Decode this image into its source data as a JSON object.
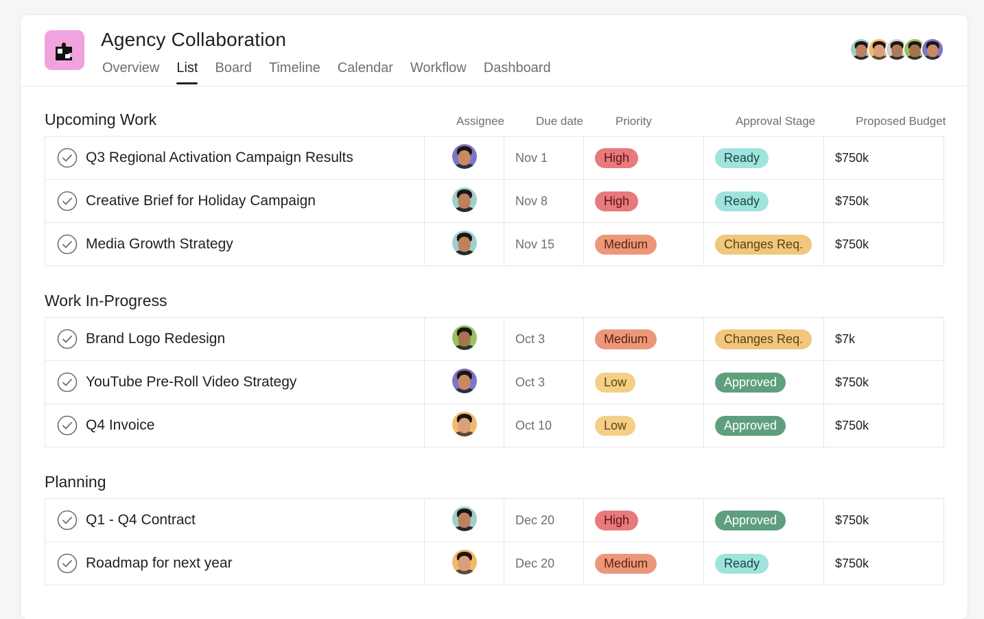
{
  "project": {
    "title": "Agency Collaboration",
    "logo_icon": "puzzle-icon",
    "logo_color": "#f0a3dd"
  },
  "tabs": [
    {
      "label": "Overview",
      "active": false
    },
    {
      "label": "List",
      "active": true
    },
    {
      "label": "Board",
      "active": false
    },
    {
      "label": "Timeline",
      "active": false
    },
    {
      "label": "Calendar",
      "active": false
    },
    {
      "label": "Workflow",
      "active": false
    },
    {
      "label": "Dashboard",
      "active": false
    }
  ],
  "members": [
    "teal",
    "orange",
    "gray",
    "green",
    "purple"
  ],
  "columns": {
    "assignee": "Assignee",
    "due_date": "Due date",
    "priority": "Priority",
    "approval": "Approval Stage",
    "budget": "Proposed Budget"
  },
  "colors": {
    "high": {
      "bg": "#e8797c",
      "fg": "#5a1416"
    },
    "medium": {
      "bg": "#ec9779",
      "fg": "#5c2313"
    },
    "low": {
      "bg": "#f4cf86",
      "fg": "#5d4410"
    },
    "ready": {
      "bg": "#9fe3dd",
      "fg": "#1a4643"
    },
    "changes": {
      "bg": "#f1c67d",
      "fg": "#5b4211"
    },
    "approved": {
      "bg": "#5f9f7e",
      "fg": "#ffffff"
    }
  },
  "sections": [
    {
      "title": "Upcoming Work",
      "show_columns": true,
      "rows": [
        {
          "name": "Q3 Regional Activation Campaign Results",
          "avatar": "purple",
          "due": "Nov 1",
          "priority": "High",
          "priority_key": "high",
          "approval": "Ready",
          "approval_key": "ready",
          "budget": "$750k"
        },
        {
          "name": "Creative Brief for Holiday Campaign",
          "avatar": "teal",
          "due": "Nov 8",
          "priority": "High",
          "priority_key": "high",
          "approval": "Ready",
          "approval_key": "ready",
          "budget": "$750k"
        },
        {
          "name": "Media Growth Strategy",
          "avatar": "teal",
          "due": "Nov 15",
          "priority": "Medium",
          "priority_key": "medium",
          "approval": "Changes Req.",
          "approval_key": "changes",
          "budget": "$750k"
        }
      ]
    },
    {
      "title": "Work In-Progress",
      "show_columns": false,
      "rows": [
        {
          "name": "Brand Logo Redesign",
          "avatar": "green",
          "due": "Oct 3",
          "priority": "Medium",
          "priority_key": "medium",
          "approval": "Changes Req.",
          "approval_key": "changes",
          "budget": "$7k"
        },
        {
          "name": "YouTube Pre-Roll Video Strategy",
          "avatar": "purple",
          "due": "Oct 3",
          "priority": "Low",
          "priority_key": "low",
          "approval": "Approved",
          "approval_key": "approved",
          "budget": "$750k"
        },
        {
          "name": "Q4 Invoice",
          "avatar": "orange",
          "due": "Oct 10",
          "priority": "Low",
          "priority_key": "low",
          "approval": "Approved",
          "approval_key": "approved",
          "budget": "$750k"
        }
      ]
    },
    {
      "title": "Planning",
      "show_columns": false,
      "rows": [
        {
          "name": "Q1 - Q4 Contract",
          "avatar": "teal",
          "due": "Dec 20",
          "priority": "High",
          "priority_key": "high",
          "approval": "Approved",
          "approval_key": "approved",
          "budget": "$750k"
        },
        {
          "name": "Roadmap for next year",
          "avatar": "orange",
          "due": "Dec 20",
          "priority": "Medium",
          "priority_key": "medium",
          "approval": "Ready",
          "approval_key": "ready",
          "budget": "$750k"
        }
      ]
    }
  ]
}
